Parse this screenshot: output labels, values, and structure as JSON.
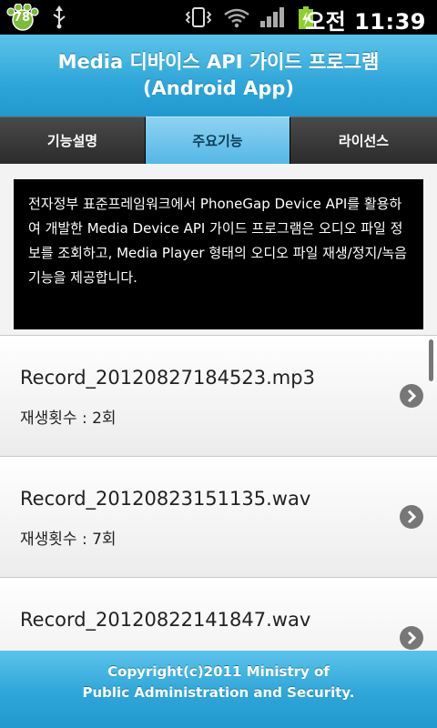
{
  "status_bar": {
    "badge_count": "78",
    "time": "오전 11:39",
    "icons": [
      "paw-badge-icon",
      "usb-icon",
      "vibrate-icon",
      "wifi-icon",
      "signal-icon",
      "battery-charging-icon"
    ]
  },
  "header": {
    "title_line1": "Media 디바이스 API 가이드 프로그램",
    "title_line2": "(Android App)"
  },
  "tabs": [
    {
      "label": "기능설명",
      "active": false
    },
    {
      "label": "주요기능",
      "active": true
    },
    {
      "label": "라이선스",
      "active": false
    }
  ],
  "description": "전자정부 표준프레임워크에서 PhoneGap Device API를 활용하여 개발한 Media Device API 가이드 프로그램은 오디오 파일 정보를 조회하고, Media Player 형태의 오디오 파일 재생/정지/녹음 기능을 제공합니다.",
  "records": [
    {
      "file": "Record_20120827184523.mp3",
      "plays": "재생횟수 : 2회"
    },
    {
      "file": "Record_20120823151135.wav",
      "plays": "재생횟수 : 7회"
    },
    {
      "file": "Record_20120822141847.wav",
      "plays": ""
    }
  ],
  "footer": {
    "line1": "Copyright(c)2011 Ministry of",
    "line2": "Public Administration and Security."
  },
  "colors": {
    "header_blue": "#2ea6d8",
    "active_tab": "#55b7e6",
    "description_bg": "#000000"
  }
}
